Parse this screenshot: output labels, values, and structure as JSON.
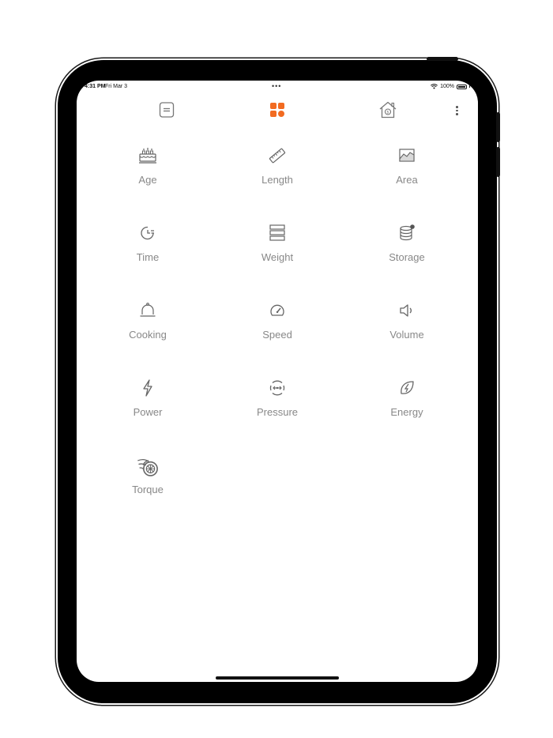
{
  "status_bar": {
    "time": "4:31 PM",
    "date": "Fri Mar 3",
    "battery": "100%"
  },
  "accent_color": "#f26b21",
  "toolbar": {
    "left_icon": "document-icon",
    "center_icon": "grid-icon",
    "right_icon": "house-icon",
    "menu_icon": "more-vertical-icon"
  },
  "categories": [
    {
      "label": "Age",
      "icon": "birthday-cake-icon"
    },
    {
      "label": "Length",
      "icon": "ruler-icon"
    },
    {
      "label": "Area",
      "icon": "area-chart-icon"
    },
    {
      "label": "Time",
      "icon": "clock-icon"
    },
    {
      "label": "Weight",
      "icon": "weight-stack-icon"
    },
    {
      "label": "Storage",
      "icon": "database-icon"
    },
    {
      "label": "Cooking",
      "icon": "cloche-icon"
    },
    {
      "label": "Speed",
      "icon": "speedometer-icon"
    },
    {
      "label": "Volume",
      "icon": "speaker-icon"
    },
    {
      "label": "Power",
      "icon": "lightning-icon"
    },
    {
      "label": "Pressure",
      "icon": "pressure-gauge-icon"
    },
    {
      "label": "Energy",
      "icon": "leaf-bolt-icon"
    },
    {
      "label": "Torque",
      "icon": "turbo-icon"
    }
  ]
}
